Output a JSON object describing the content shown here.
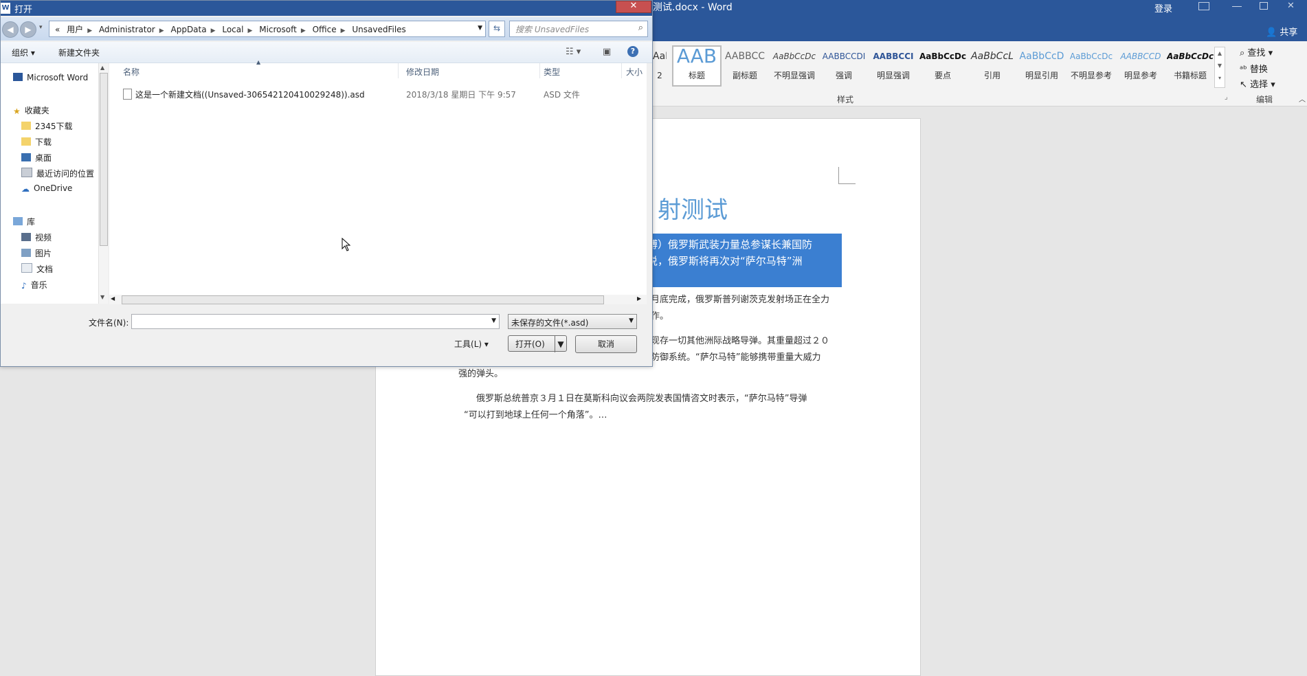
{
  "word": {
    "title": "测试.docx - Word",
    "login": "登录",
    "share": "共享",
    "styles": [
      {
        "sample": "AaBbCcD",
        "name": "2"
      },
      {
        "sample": "AAB",
        "name": "标题"
      },
      {
        "sample": "AABBCC",
        "name": "副标题"
      },
      {
        "sample": "AaBbCcDc",
        "name": "不明显强调"
      },
      {
        "sample": "AABBCCDI",
        "name": "强调"
      },
      {
        "sample": "AABBCCI",
        "name": "明显强调"
      },
      {
        "sample": "AaBbCcDc",
        "name": "要点"
      },
      {
        "sample": "AaBbCcL",
        "name": "引用"
      },
      {
        "sample": "AaBbCcD",
        "name": "明显引用"
      },
      {
        "sample": "AaBbCcDc",
        "name": "不明显参考"
      },
      {
        "sample": "AABBCCD",
        "name": "明显参考"
      },
      {
        "sample": "AaBbCcDc",
        "name": "书籍标题"
      }
    ],
    "styles_group": "样式",
    "edit_group": "编辑",
    "edit_find": "查找",
    "edit_replace": "替换",
    "edit_select": "选择",
    "doc_title": "射测试",
    "selected_line1": "博）俄罗斯武装力量总参谋长兼国防",
    "selected_line2": "说，俄罗斯将再次对“萨尔马特”洲",
    "para1_line1": "月底完成，俄罗斯普列谢茨克发射场正在全力",
    "para1_line2": "作。",
    "para2_line1": "现存一切其他洲际战略导弹。其重量超过２０",
    "para2_line2": "防御系统。“萨尔马特”能够携带重量大威力",
    "para2_line3": "强的弹头。",
    "para3_line1": "俄罗斯总统普京３月１日在莫斯科向议会两院发表国情咨文时表示，“萨尔马特”导弹",
    "para3_line2": "“可以打到地球上任何一个角落”。…"
  },
  "dialog": {
    "title": "打开",
    "breadcrumbs": [
      "«",
      "用户",
      "Administrator",
      "AppData",
      "Local",
      "Microsoft",
      "Office",
      "UnsavedFiles"
    ],
    "search_placeholder": "搜索 UnsavedFiles",
    "toolbar": {
      "organize": "组织",
      "new_folder": "新建文件夹"
    },
    "nav": {
      "word": "Microsoft Word",
      "favorites": "收藏夹",
      "fav_items": [
        "2345下载",
        "下载",
        "桌面",
        "最近访问的位置"
      ],
      "onedrive": "OneDrive",
      "libraries": "库",
      "lib_items": [
        "视频",
        "图片",
        "文档",
        "音乐"
      ]
    },
    "columns": {
      "name": "名称",
      "modified": "修改日期",
      "type": "类型",
      "size": "大小"
    },
    "files": [
      {
        "name": "这是一个新建文档((Unsaved-306542120410029248)).asd",
        "modified": "2018/3/18 星期日 下午 9:57",
        "type": "ASD 文件"
      }
    ],
    "filename_label": "文件名(N):",
    "filename_value": "",
    "filetype": "未保存的文件(*.asd)",
    "tools": "工具(L)",
    "open": "打开(O)",
    "cancel": "取消"
  }
}
